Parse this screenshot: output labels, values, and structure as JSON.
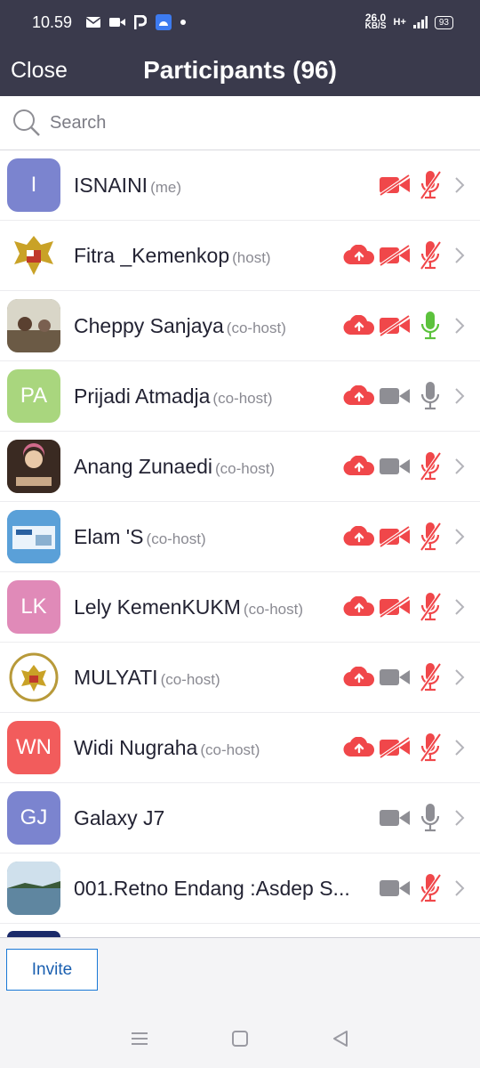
{
  "status_bar": {
    "time": "10.59",
    "net_speed": "26.0",
    "net_unit": "KB/S",
    "network": "H+",
    "battery": "93"
  },
  "header": {
    "close_label": "Close",
    "title": "Participants (96)"
  },
  "search": {
    "placeholder": "Search"
  },
  "participants": [
    {
      "name": "ISNAINI",
      "role": "(me)",
      "initials": "I",
      "avatar_color": "#7b84cf",
      "cloud": false,
      "video": "off",
      "mic": "muted"
    },
    {
      "name": "Fitra _Kemenkop",
      "role": "(host)",
      "initials": "",
      "avatar_color": "#ffffff",
      "cloud": true,
      "video": "off",
      "mic": "muted"
    },
    {
      "name": "Cheppy Sanjaya",
      "role": "(co-host)",
      "initials": "",
      "avatar_color": "#8a8a7a",
      "cloud": true,
      "video": "off",
      "mic": "active"
    },
    {
      "name": "Prijadi Atmadja",
      "role": "(co-host)",
      "initials": "PA",
      "avatar_color": "#a9d67e",
      "cloud": true,
      "video": "on",
      "mic": "on"
    },
    {
      "name": "Anang Zunaedi",
      "role": "(co-host)",
      "initials": "",
      "avatar_color": "#6a4a3a",
      "cloud": true,
      "video": "on",
      "mic": "muted"
    },
    {
      "name": "Elam 'S",
      "role": "(co-host)",
      "initials": "",
      "avatar_color": "#3a7ac0",
      "cloud": true,
      "video": "off",
      "mic": "muted"
    },
    {
      "name": "Lely KemenKUKM",
      "role": "(co-host)",
      "initials": "LK",
      "avatar_color": "#e08ab8",
      "cloud": true,
      "video": "off",
      "mic": "muted"
    },
    {
      "name": "MULYATI",
      "role": "(co-host)",
      "initials": "",
      "avatar_color": "#ffffff",
      "cloud": true,
      "video": "on",
      "mic": "muted"
    },
    {
      "name": "Widi Nugraha",
      "role": "(co-host)",
      "initials": "WN",
      "avatar_color": "#f25c5c",
      "cloud": true,
      "video": "off",
      "mic": "muted"
    },
    {
      "name": "Galaxy J7",
      "role": "",
      "initials": "GJ",
      "avatar_color": "#7b84cf",
      "cloud": false,
      "video": "on",
      "mic": "on"
    },
    {
      "name": "001.Retno Endang :Asdep S...",
      "role": "",
      "initials": "",
      "avatar_color": "#8aa4b8",
      "cloud": false,
      "video": "on",
      "mic": "muted"
    }
  ],
  "footer": {
    "invite_label": "Invite"
  },
  "colors": {
    "header_bg": "#3a3a4c",
    "red": "#f0474a",
    "gray_icon": "#8e8e94",
    "green_mic": "#5cc23c",
    "link_blue": "#1a78d6"
  }
}
